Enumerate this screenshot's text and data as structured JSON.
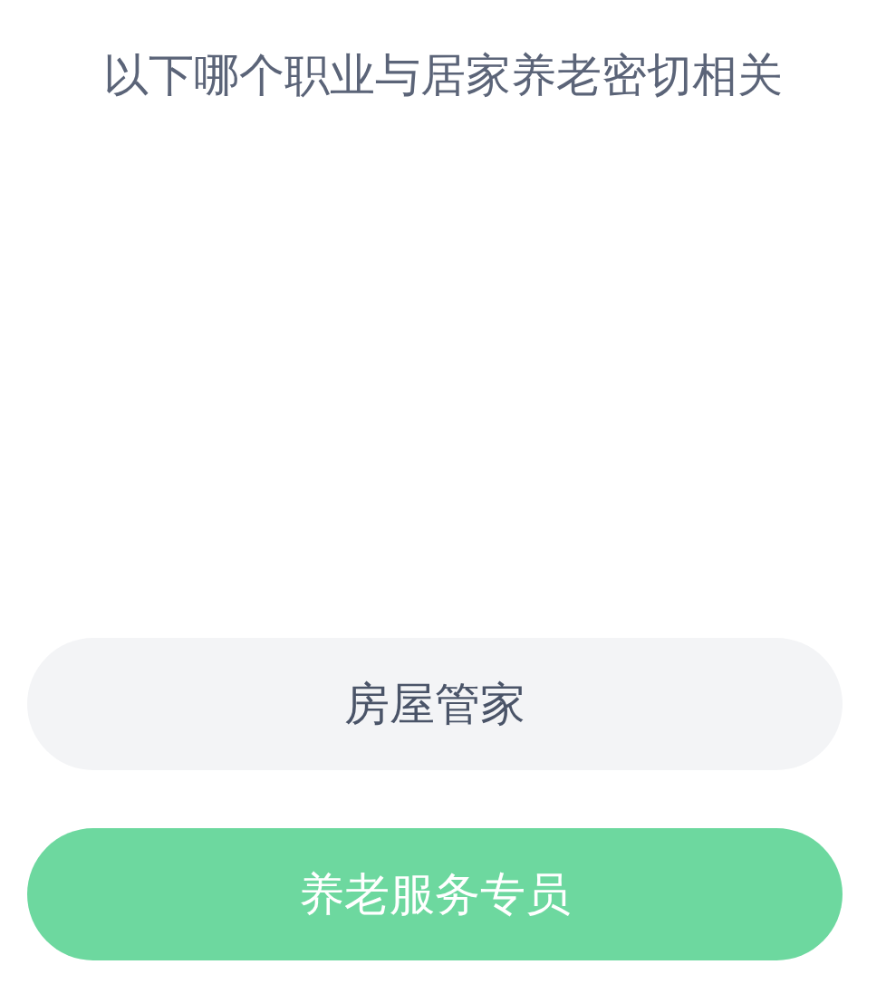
{
  "question": "以下哪个职业与居家养老密切相关",
  "options": [
    {
      "label": "房屋管家",
      "selected": false
    },
    {
      "label": "养老服务专员",
      "selected": true
    }
  ]
}
